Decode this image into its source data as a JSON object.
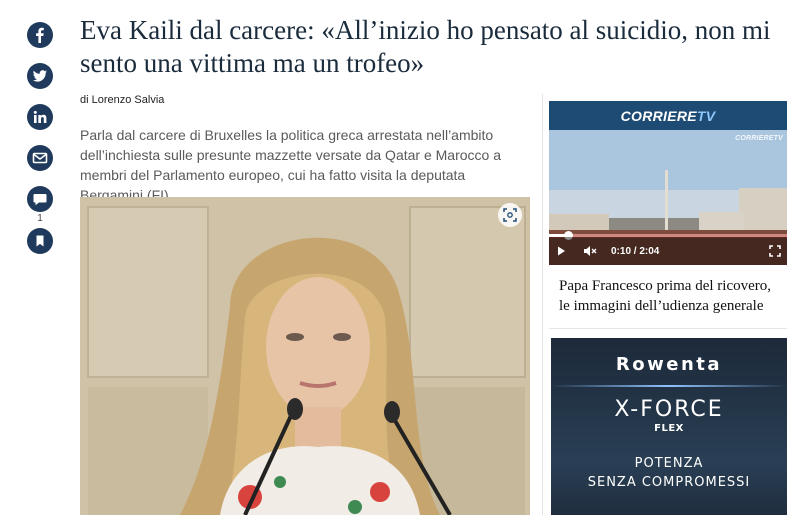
{
  "share": {
    "icons": [
      "facebook-icon",
      "twitter-icon",
      "linkedin-icon",
      "email-icon",
      "comment-icon",
      "bookmark-icon"
    ],
    "comment_count": "1",
    "color": "#1f3a5c"
  },
  "article": {
    "headline": "Eva Kaili dal carcere: «All’inizio ho pensato al suicidio, non mi sento una vittima ma un trofeo»",
    "byline": "di Lorenzo Salvia",
    "summary": "Parla dal carcere di Bruxelles la politica greca arrestata nell’ambito dell’inchiesta sulle presunte mazzette versate da Qatar e Marocco a membri del Parlamento europeo, cui ha fatto visita la deputata Bergamini (FI)",
    "headline_color": "#1a2b3c"
  },
  "tv": {
    "brand_main": "CORRIERE",
    "brand_accent": "TV",
    "watermark": "CORRIERETV",
    "time": "0:10 / 2:04",
    "progress": 0.08,
    "caption": "Papa Francesco prima del ricovero, le immagini dell’udienza generale",
    "header_color": "#1e4b73"
  },
  "ad": {
    "brand": "Rowenta",
    "product": "X-FORCE",
    "product_sub": "FLEX",
    "tagline_1": "POTENZA",
    "tagline_2": "SENZA COMPROMESSI"
  }
}
